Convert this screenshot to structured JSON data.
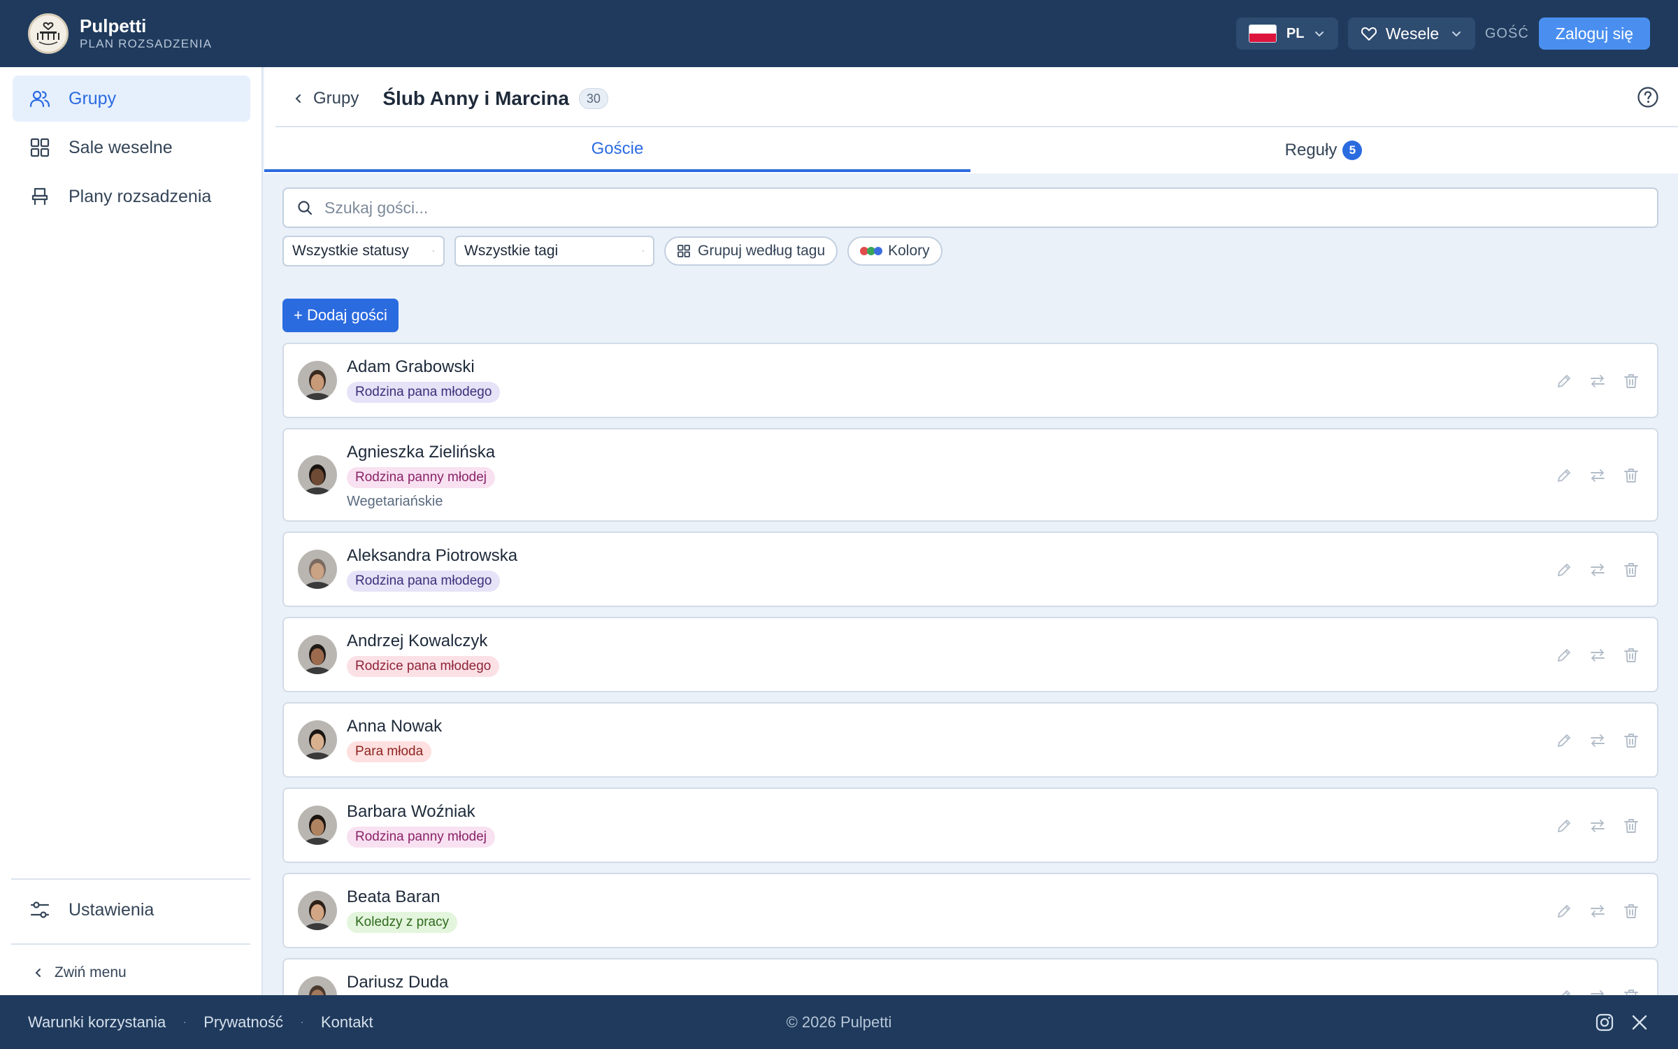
{
  "app": {
    "name": "Pulpetti",
    "subtitle": "PLAN ROZSADZENIA",
    "logo_text": "PULPETTI"
  },
  "header": {
    "language": {
      "code": "PL",
      "flag": "poland-flag-icon"
    },
    "event_selector": {
      "label": "Wesele",
      "icon": "heart-icon"
    },
    "user_role": "GOŚĆ",
    "login_label": "Zaloguj się"
  },
  "sidebar": {
    "items": [
      {
        "label": "Grupy",
        "icon": "users-icon",
        "active": true
      },
      {
        "label": "Sale weselne",
        "icon": "grid-icon",
        "active": false
      },
      {
        "label": "Plany rozsadzenia",
        "icon": "chair-icon",
        "active": false
      }
    ],
    "settings_label": "Ustawienia",
    "collapse_label": "Zwiń menu"
  },
  "page": {
    "back_label": "Grupy",
    "title": "Ślub Anny i Marcina",
    "guest_count": "30",
    "tabs": [
      {
        "label": "Goście",
        "active": true
      },
      {
        "label": "Reguły",
        "badge": "5",
        "active": false
      }
    ]
  },
  "search": {
    "placeholder": "Szukaj gości...",
    "value": ""
  },
  "filters": {
    "status": "Wszystkie statusy",
    "tags": "Wszystkie tagi",
    "group_by_tag": "Grupuj według tagu",
    "colors": "Kolory"
  },
  "add_guest_label": "+ Dodaj gości",
  "guests": [
    {
      "name": "Adam Grabowski",
      "tag": "Rodzina pana młodego",
      "tag_style": "lavender",
      "note": ""
    },
    {
      "name": "Agnieszka Zielińska",
      "tag": "Rodzina panny młodej",
      "tag_style": "pink",
      "note": "Wegetariańskie"
    },
    {
      "name": "Aleksandra Piotrowska",
      "tag": "Rodzina pana młodego",
      "tag_style": "lavender",
      "note": ""
    },
    {
      "name": "Andrzej Kowalczyk",
      "tag": "Rodzice pana młodego",
      "tag_style": "rose",
      "note": ""
    },
    {
      "name": "Anna Nowak",
      "tag": "Para młoda",
      "tag_style": "red",
      "note": ""
    },
    {
      "name": "Barbara Woźniak",
      "tag": "Rodzina panny młodej",
      "tag_style": "pink",
      "note": ""
    },
    {
      "name": "Beata Baran",
      "tag": "Koledzy z pracy",
      "tag_style": "green",
      "note": ""
    },
    {
      "name": "Dariusz Duda",
      "tag": "",
      "tag_style": "",
      "note": ""
    }
  ],
  "tag_colors": {
    "lavender": {
      "bg": "#e6e2f7",
      "fg": "#3c2f7a"
    },
    "pink": {
      "bg": "#f8e1f1",
      "fg": "#8a2468"
    },
    "rose": {
      "bg": "#fbe1e6",
      "fg": "#8f2438"
    },
    "red": {
      "bg": "#fde0df",
      "fg": "#8e2420"
    },
    "green": {
      "bg": "#e3f5dc",
      "fg": "#2f6a1e"
    }
  },
  "footer": {
    "links": [
      "Warunki korzystania",
      "Prywatność",
      "Kontakt"
    ],
    "copyright": "© 2026 Pulpetti",
    "socials": [
      "instagram-icon",
      "x-icon"
    ]
  },
  "colors": {
    "primary": "#2b6be0",
    "header_bg": "#1f3a5c",
    "page_bg": "#eaf1f9"
  }
}
